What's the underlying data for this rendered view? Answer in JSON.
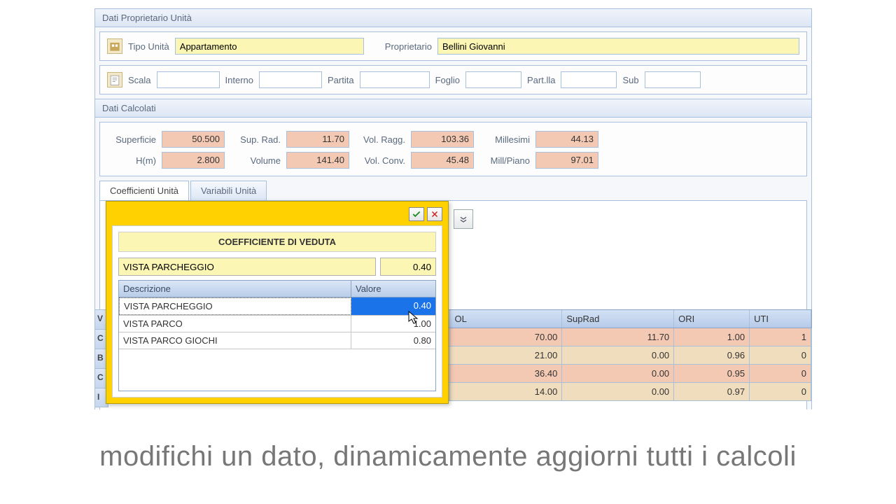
{
  "groups": {
    "owner_title": "Dati Proprietario Unità",
    "calc_title": "Dati Calcolati"
  },
  "owner": {
    "tipo_unita_label": "Tipo Unità",
    "tipo_unita_value": "Appartamento",
    "proprietario_label": "Proprietario",
    "proprietario_value": "Bellini Giovanni",
    "scala_label": "Scala",
    "interno_label": "Interno",
    "partita_label": "Partita",
    "foglio_label": "Foglio",
    "partlla_label": "Part.lla",
    "sub_label": "Sub"
  },
  "calc": {
    "superficie_label": "Superficie",
    "superficie_value": "50.500",
    "suprad_label": "Sup. Rad.",
    "suprad_value": "11.70",
    "volragg_label": "Vol. Ragg.",
    "volragg_value": "103.36",
    "millesimi_label": "Millesimi",
    "millesimi_value": "44.13",
    "hm_label": "H(m)",
    "hm_value": "2.800",
    "volume_label": "Volume",
    "volume_value": "141.40",
    "volconv_label": "Vol. Conv.",
    "volconv_value": "45.48",
    "millpiano_label": "Mill/Piano",
    "millpiano_value": "97.01"
  },
  "tabs": {
    "t1": "Coefficienti Unità",
    "t2": "Variabili Unità"
  },
  "popup": {
    "title": "COEFFICIENTE DI VEDUTA",
    "desc_value": "VISTA PARCHEGGIO",
    "val_value": "0.40",
    "header_desc": "Descrizione",
    "header_val": "Valore",
    "rows": [
      {
        "desc": "VISTA PARCHEGGIO",
        "val": "0.40"
      },
      {
        "desc": "VISTA PARCO",
        "val": "1.00"
      },
      {
        "desc": "VISTA PARCO GIOCHI",
        "val": "0.80"
      }
    ]
  },
  "bg_grid": {
    "headers": {
      "a": "V",
      "b": "C",
      "c": "B",
      "d": "C",
      "e": "I",
      "col1": "OL",
      "col2": "SupRad",
      "col3": "ORI",
      "col4": "UTI"
    },
    "rows": [
      {
        "col1": "70.00",
        "col2": "11.70",
        "col3": "1.00",
        "col4": "1"
      },
      {
        "col1": "21.00",
        "col2": "0.00",
        "col3": "0.96",
        "col4": "0"
      },
      {
        "col1": "36.40",
        "col2": "0.00",
        "col3": "0.95",
        "col4": "0"
      },
      {
        "col1": "14.00",
        "col2": "0.00",
        "col3": "0.97",
        "col4": "0"
      }
    ]
  },
  "caption": "modifichi un dato, dinamicamente aggiorni tutti i calcoli"
}
